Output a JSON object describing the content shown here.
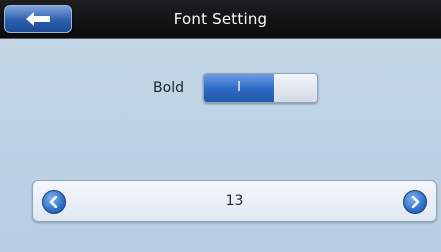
{
  "header": {
    "title": "Font Setting",
    "back_icon": "back-arrow-icon"
  },
  "bold_setting": {
    "label": "Bold",
    "state": "on",
    "on_text": "I"
  },
  "size_stepper": {
    "value": "13",
    "decrease_icon": "chevron-left-icon",
    "increase_icon": "chevron-right-icon"
  },
  "colors": {
    "accent": "#2f6cc8",
    "titlebar": "#111112",
    "background": "#c4d7e6"
  }
}
